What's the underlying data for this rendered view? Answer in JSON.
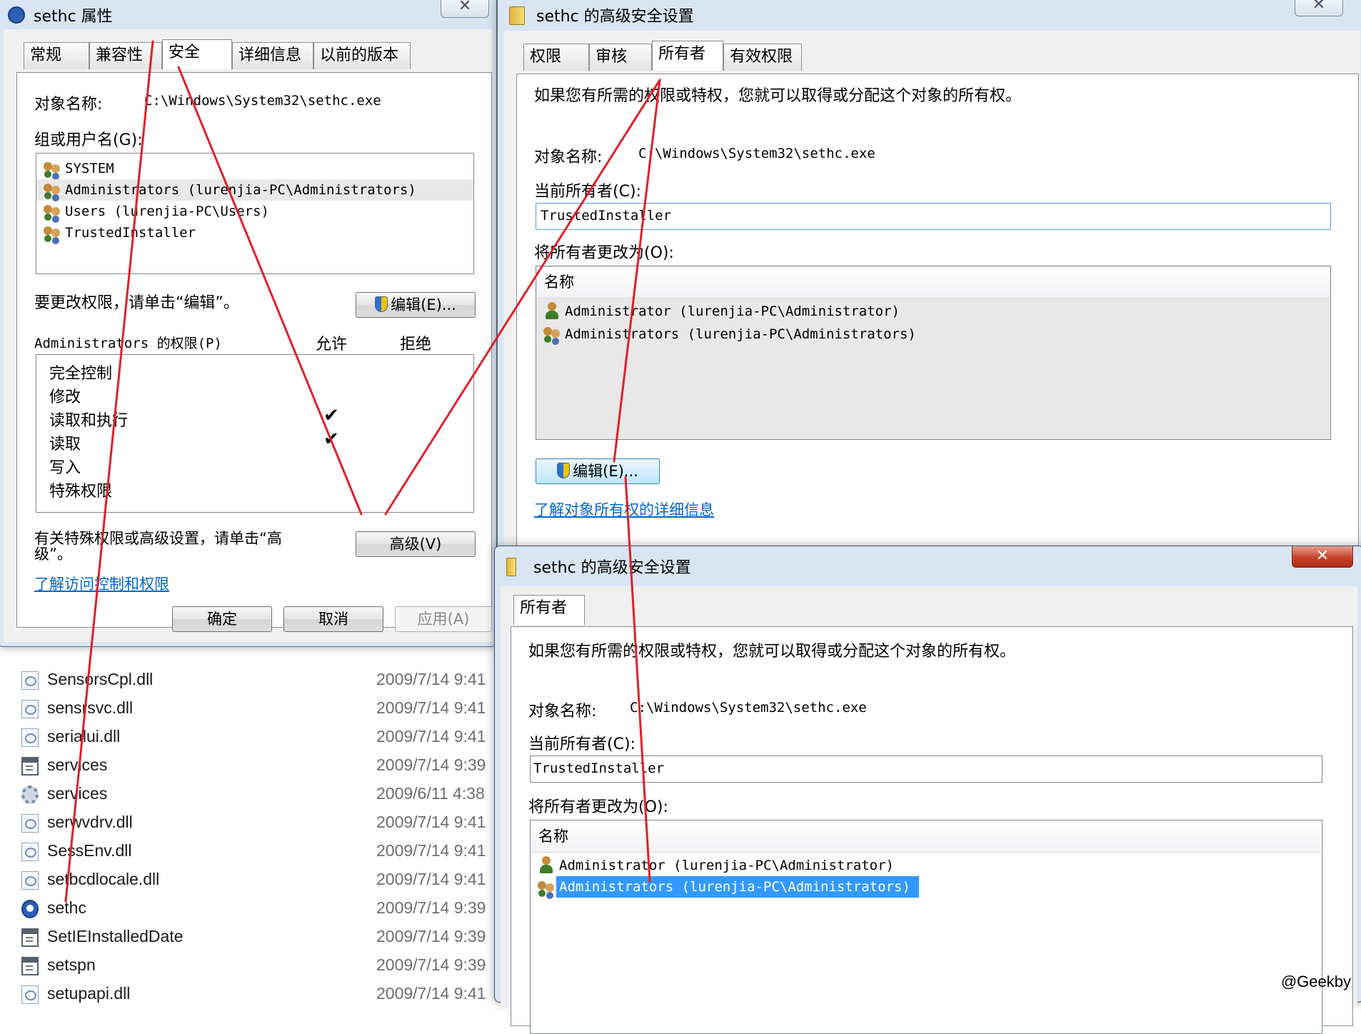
{
  "file_list": [
    {
      "name": "SensorsCpl.dll",
      "date": "2009/7/14 9:41",
      "icon": "dll-file-icon"
    },
    {
      "name": "sensrsvc.dll",
      "date": "2009/7/14 9:41",
      "icon": "dll-file-icon"
    },
    {
      "name": "serialui.dll",
      "date": "2009/7/14 9:41",
      "icon": "dll-file-icon"
    },
    {
      "name": "services",
      "date": "2009/7/14 9:39",
      "icon": "app-window-icon"
    },
    {
      "name": "services",
      "date": "2009/6/11 4:38",
      "icon": "gear-file-icon"
    },
    {
      "name": "serwvdrv.dll",
      "date": "2009/7/14 9:41",
      "icon": "dll-file-icon"
    },
    {
      "name": "SessEnv.dll",
      "date": "2009/7/14 9:41",
      "icon": "dll-file-icon"
    },
    {
      "name": "setbcdlocale.dll",
      "date": "2009/7/14 9:41",
      "icon": "dll-file-icon"
    },
    {
      "name": "sethc",
      "date": "2009/7/14 9:39",
      "icon": "sethc-app-icon"
    },
    {
      "name": "SetIEInstalledDate",
      "date": "2009/7/14 9:39",
      "icon": "app-window-icon"
    },
    {
      "name": "setspn",
      "date": "2009/7/14 9:39",
      "icon": "app-window-icon"
    },
    {
      "name": "setupapi.dll",
      "date": "2009/7/14 9:41",
      "icon": "dll-file-icon"
    }
  ],
  "props": {
    "title": "sethc 属性",
    "close": "✕",
    "tabs": [
      "常规",
      "兼容性",
      "安全",
      "详细信息",
      "以前的版本"
    ],
    "object_name_label": "对象名称:",
    "object_name_value": "C:\\Windows\\System32\\sethc.exe",
    "group_label": "组或用户名(G):",
    "users": [
      "SYSTEM",
      "Administrators (lurenjia-PC\\Administrators)",
      "Users (lurenjia-PC\\Users)",
      "TrustedInstaller"
    ],
    "edit_hint": "要更改权限，请单击“编辑”。",
    "edit_button": "编辑(E)...",
    "perm_label": "Administrators 的权限(P)",
    "allow": "允许",
    "deny": "拒绝",
    "permissions": [
      "完全控制",
      "修改",
      "读取和执行",
      "读取",
      "写入",
      "特殊权限"
    ],
    "check_mark": "✔",
    "adv_hint_1": "有关特殊权限或高级设置，请单击“高",
    "adv_hint_2": "级”。",
    "advanced_button": "高级(V)",
    "learn_link": "了解访问控制和权限",
    "ok": "确定",
    "cancel": "取消",
    "apply": "应用(A)"
  },
  "adv1": {
    "title": "sethc 的高级安全设置",
    "close": "✕",
    "tabs": [
      "权限",
      "审核",
      "所有者",
      "有效权限"
    ],
    "intro": "如果您有所需的权限或特权，您就可以取得或分配这个对象的所有权。",
    "object_name_label": "对象名称:",
    "object_name_value": "C:\\Windows\\System32\\sethc.exe",
    "owner_label": "当前所有者(C):",
    "owner_value": "TrustedInstaller",
    "change_label": "将所有者更改为(O):",
    "col_name": "名称",
    "entries": [
      "Administrator (lurenjia-PC\\Administrator)",
      "Administrators (lurenjia-PC\\Administrators)"
    ],
    "edit_button": "编辑(E)...",
    "learn_link": "了解对象所有权的详细信息"
  },
  "adv2": {
    "title": "sethc 的高级安全设置",
    "close": "✕",
    "tab": "所有者",
    "intro": "如果您有所需的权限或特权，您就可以取得或分配这个对象的所有权。",
    "object_name_label": "对象名称:",
    "object_name_value": "C:\\Windows\\System32\\sethc.exe",
    "owner_label": "当前所有者(C):",
    "owner_value": "TrustedInstaller",
    "change_label": "将所有者更改为(O):",
    "col_name": "名称",
    "entries": [
      "Administrator (lurenjia-PC\\Administrator)",
      "Administrators (lurenjia-PC\\Administrators)"
    ]
  },
  "watermark": "@Geekby",
  "colors": {
    "annotation": "#e0202a",
    "selection": "#3399ff",
    "link": "#0066cc"
  }
}
